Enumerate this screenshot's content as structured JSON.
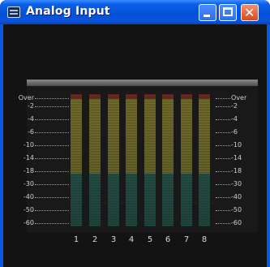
{
  "window": {
    "title": "Analog Input",
    "icon": "mixer-window-icon"
  },
  "controls": {
    "minimize": "minimize-icon",
    "maximize": "maximize-icon",
    "close_glyph": "✕"
  },
  "scale_labels": [
    "Over",
    "-2",
    "-4",
    "-6",
    "-10",
    "-14",
    "-18",
    "-30",
    "-40",
    "-50",
    "-60"
  ],
  "channels": [
    "1",
    "2",
    "3",
    "4",
    "5",
    "6",
    "7",
    "8"
  ],
  "colors": {
    "over": "#7a2a26",
    "mid": "#7c7420",
    "low": "#21564a",
    "titlebar": "#0650d8"
  }
}
